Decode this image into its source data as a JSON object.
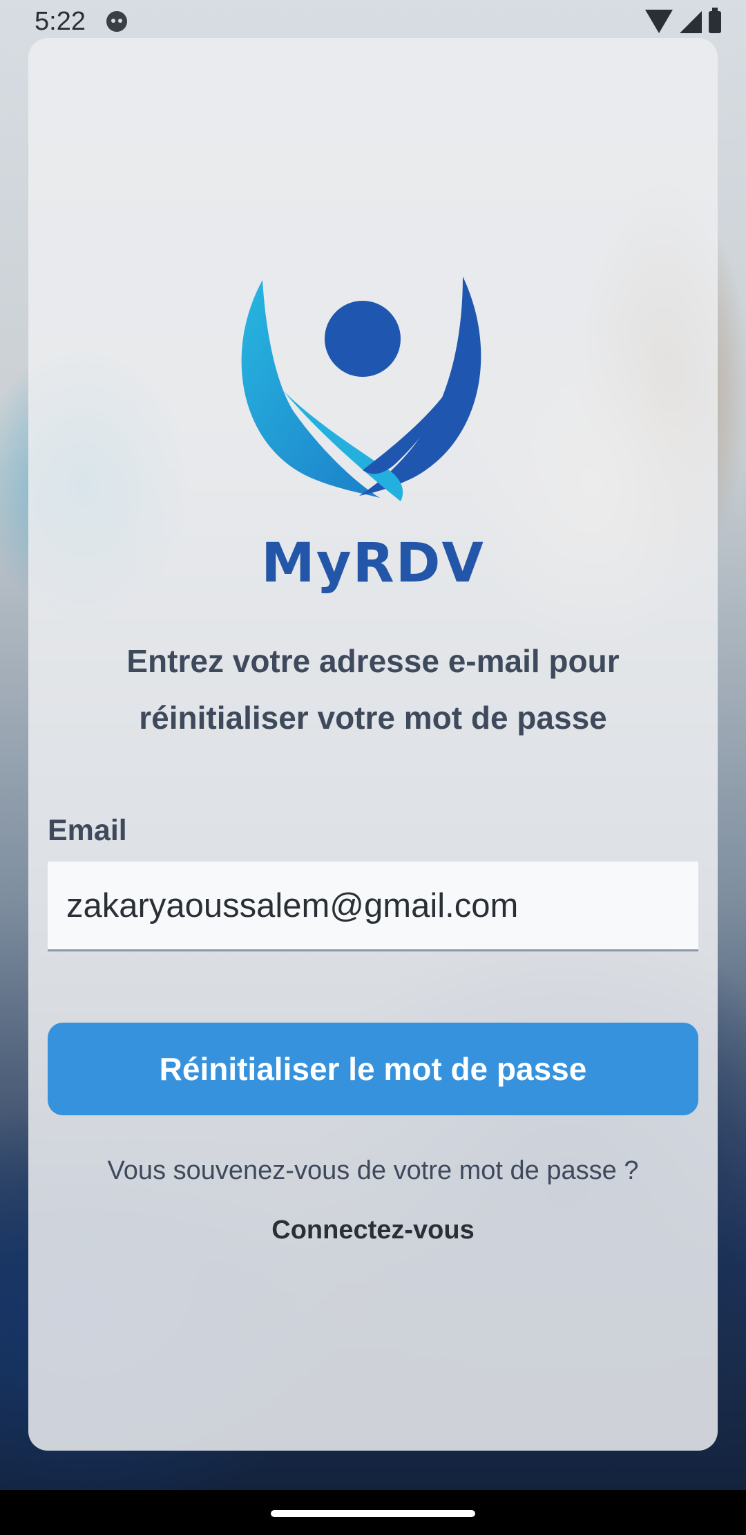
{
  "status_bar": {
    "time": "5:22",
    "icons": [
      "face-icon",
      "wifi-icon",
      "signal-icon",
      "battery-icon"
    ]
  },
  "brand": {
    "name": "MyRDV",
    "colors": {
      "primary": "#2356a8",
      "accent": "#2bbfe0"
    }
  },
  "form": {
    "instruction": "Entrez votre adresse e-mail pour réinitialiser votre mot de passe",
    "email_label": "Email",
    "email_value": "zakaryaoussalem@gmail.com",
    "submit_label": "Réinitialiser le mot de passe",
    "submit_color": "#3692dc"
  },
  "footer": {
    "remember_text": "Vous souvenez-vous de votre mot de passe ?",
    "login_link": "Connectez-vous"
  }
}
